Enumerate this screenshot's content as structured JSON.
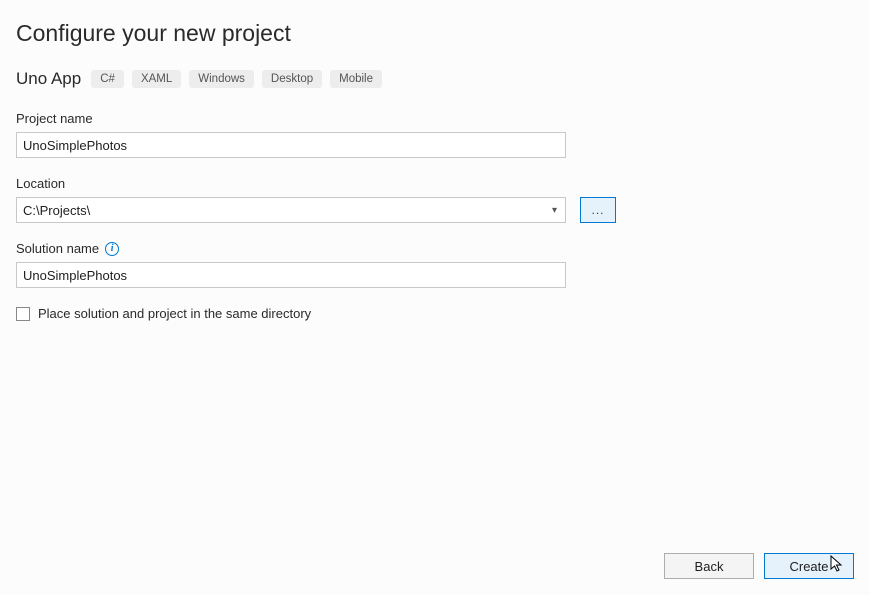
{
  "header": {
    "title": "Configure your new project",
    "subtitle": "Uno App"
  },
  "tags": [
    "C#",
    "XAML",
    "Windows",
    "Desktop",
    "Mobile"
  ],
  "fields": {
    "project_name": {
      "label": "Project name",
      "value": "UnoSimplePhotos"
    },
    "location": {
      "label": "Location",
      "value": "C:\\Projects\\",
      "browse": "..."
    },
    "solution_name": {
      "label": "Solution name",
      "value": "UnoSimplePhotos"
    }
  },
  "checkbox": {
    "label": "Place solution and project in the same directory",
    "checked": false
  },
  "footer": {
    "back": "Back",
    "create": "Create"
  }
}
